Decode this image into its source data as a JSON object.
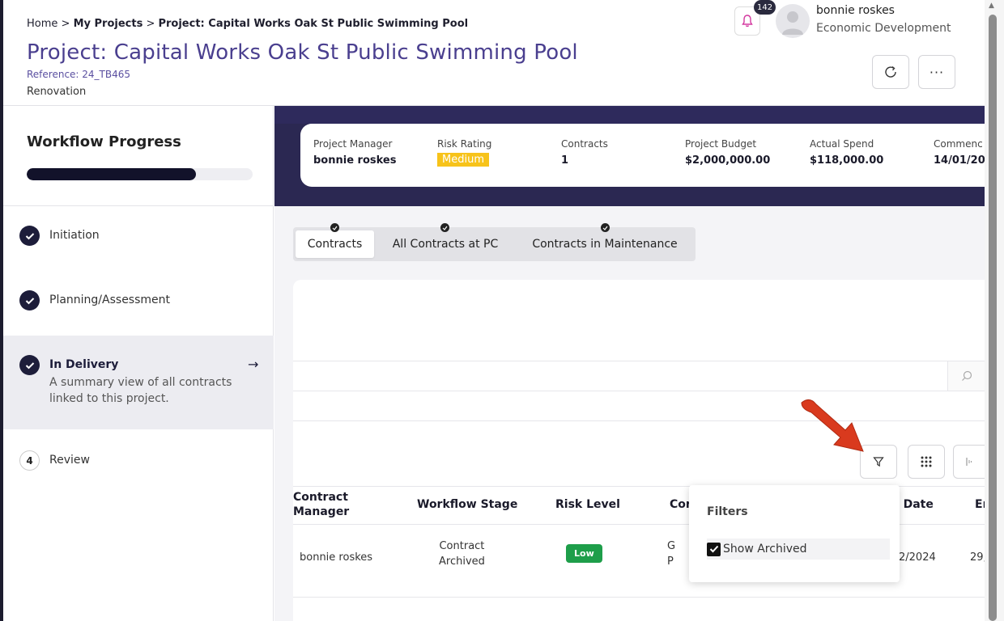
{
  "breadcrumb": {
    "home": "Home",
    "sep1": " > ",
    "projects": "My Projects",
    "sep2": " > ",
    "current": "Project: Capital Works Oak St Public Swimming Pool"
  },
  "page": {
    "title": "Project: Capital Works Oak St Public Swimming Pool",
    "reference": "Reference: 24_TB465",
    "type": "Renovation"
  },
  "header": {
    "notification_count": "142",
    "user_name": "bonnie roskes",
    "user_department": "Economic Development",
    "more_label": "···",
    "icons": {
      "bell": "bell-icon",
      "refresh": "refresh-icon",
      "more": "more-icon",
      "avatar": "user-avatar-icon"
    }
  },
  "sidebar": {
    "title": "Workflow Progress",
    "progress": 0.75,
    "steps": [
      {
        "label": "Initiation",
        "state": "complete"
      },
      {
        "label": "Planning/Assessment",
        "state": "complete"
      },
      {
        "label": "In Delivery",
        "state": "active",
        "description": "A summary view of all contracts linked to this project."
      },
      {
        "label": "Review",
        "number": "4",
        "state": "pending"
      }
    ]
  },
  "summary": {
    "project_manager_label": "Project Manager",
    "project_manager": "bonnie roskes",
    "risk_rating_label": "Risk Rating",
    "risk_rating": "Medium",
    "contracts_label": "Contracts",
    "contracts": "1",
    "budget_label": "Project Budget",
    "budget": "$2,000,000.00",
    "spend_label": "Actual Spend",
    "spend": "$118,000.00",
    "commence_label": "Commenc",
    "commence": "14/01/20"
  },
  "tabs": [
    {
      "label": "Contracts",
      "selected": true
    },
    {
      "label": "All Contracts at PC",
      "selected": false
    },
    {
      "label": "Contracts in Maintenance",
      "selected": false
    }
  ],
  "table": {
    "headers": {
      "contract_manager": "Contract\nManager",
      "workflow_stage": "Workflow Stage",
      "risk_level": "Risk Level",
      "col4": "Cor",
      "start_date": "t Date",
      "end": "Er"
    },
    "rows": [
      {
        "contract_manager": "bonnie roskes",
        "workflow_stage": "Contract\nArchived",
        "risk_level": "Low",
        "col4": "G\nP",
        "start_date": "2/2024",
        "end": "29,"
      }
    ]
  },
  "filters": {
    "title": "Filters",
    "show_archived_label": "Show Archived",
    "show_archived": true
  },
  "colors": {
    "title_purple": "#4a3f8f",
    "banner": "#2b2852",
    "risk_medium": "#f7c31a",
    "risk_low": "#1e9e4a",
    "pointer_arrow": "#d93a1e"
  }
}
